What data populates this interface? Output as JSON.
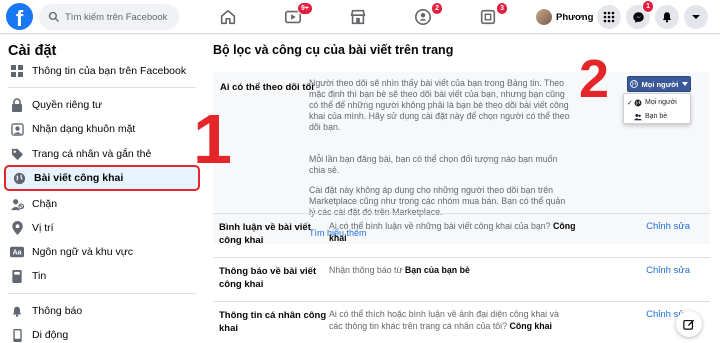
{
  "topbar": {
    "logo": "f",
    "search_placeholder": "Tìm kiếm trên Facebook",
    "badges": {
      "watch": "9+",
      "groups": "2",
      "gaming": "3",
      "messenger": "1"
    },
    "profile_name": "Phương"
  },
  "sidebar": {
    "title": "Cài đặt",
    "items": [
      {
        "label": "Thông tin của bạn trên Facebook",
        "icon": "grid-icon"
      },
      {
        "label": "Quyền riêng tư",
        "icon": "lock-icon"
      },
      {
        "label": "Nhận dạng khuôn mặt",
        "icon": "face-scan-icon"
      },
      {
        "label": "Trang cá nhân và gắn thẻ",
        "icon": "tag-icon"
      },
      {
        "label": "Bài viết công khai",
        "icon": "globe-icon"
      },
      {
        "label": "Chặn",
        "icon": "block-user-icon"
      },
      {
        "label": "Vị trí",
        "icon": "location-pin-icon"
      },
      {
        "label": "Ngôn ngữ và khu vực",
        "icon": "language-icon"
      },
      {
        "label": "Tin",
        "icon": "book-icon"
      },
      {
        "label": "Thông báo",
        "icon": "bell-icon"
      },
      {
        "label": "Di động",
        "icon": "mobile-icon"
      }
    ]
  },
  "annotations": {
    "step1": "1",
    "step2": "2"
  },
  "main": {
    "title": "Bộ lọc và công cụ của bài viết trên trang",
    "follow": {
      "title": "Ai có thể theo dõi tôi",
      "para1": "Người theo dõi sẽ nhìn thấy bài viết của bạn trong Bảng tin. Theo mặc định thì bạn bè sẽ theo dõi bài viết của bạn, nhưng bạn cũng có thể để những người không phải là bạn bè theo dõi bài viết công khai của mình. Hãy sử dụng cài đặt này để chọn người có thể theo dõi bạn.",
      "para2": "Mỗi lần bạn đăng bài, bạn có thể chọn đối tượng nào bạn muốn chia sẻ.",
      "para3": "Cài đặt này không áp dụng cho những người theo dõi bạn trên Marketplace cũng như trong các nhóm mua bán. Bạn có thể quản lý các cài đặt đó trên Marketplace.",
      "learn_more": "Tìm hiểu thêm",
      "dropdown_selected": "Mọi người",
      "dropdown_options": [
        "Mọi người",
        "Bạn bè"
      ]
    },
    "rows": [
      {
        "title": "Bình luận về bài viết công khai",
        "desc": "Ai có thể bình luận về những bài viết công khai của bạn?",
        "value": "Công khai",
        "edit": "Chỉnh sửa"
      },
      {
        "title": "Thông báo về bài viết công khai",
        "desc": "Nhận thông báo từ",
        "value": "Bạn của bạn bè",
        "edit": "Chỉnh sửa"
      },
      {
        "title": "Thông tin cá nhân công khai",
        "desc": "Ai có thể thích hoặc bình luận về ảnh đại diện công khai và các thông tin khác trên trang cá nhân của tôi?",
        "value": "Công khai",
        "edit": "Chỉnh sửa"
      }
    ]
  }
}
